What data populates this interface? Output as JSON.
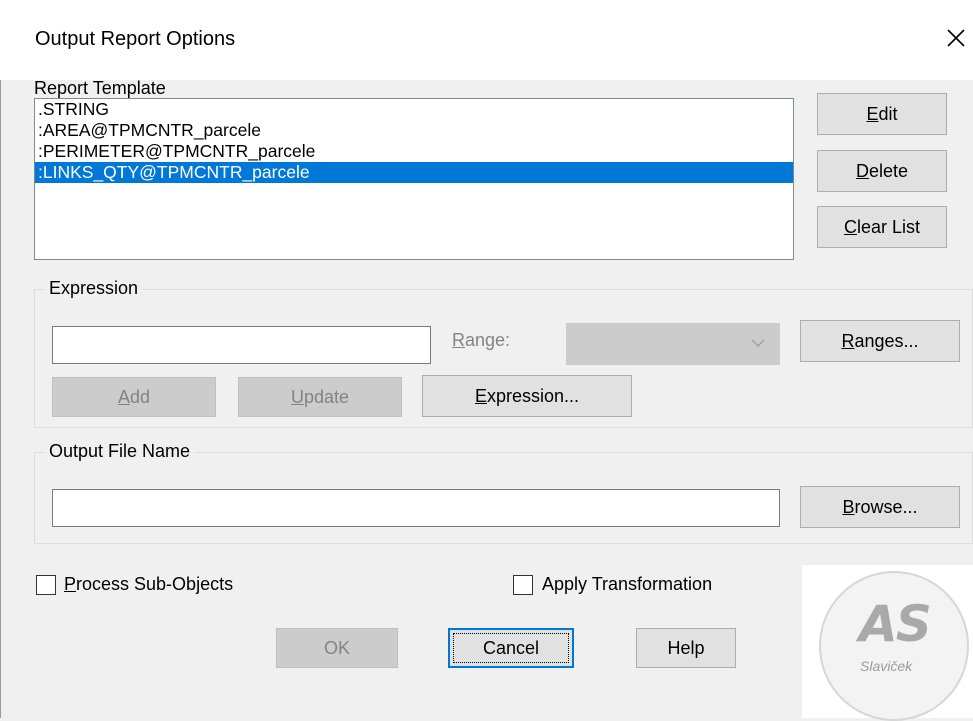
{
  "dialog": {
    "title": "Output Report Options"
  },
  "report_template": {
    "label": "Report Template",
    "items": [
      {
        "text": ".STRING",
        "selected": false
      },
      {
        "text": ":AREA@TPMCNTR_parcele",
        "selected": false
      },
      {
        "text": ":PERIMETER@TPMCNTR_parcele",
        "selected": false
      },
      {
        "text": ":LINKS_QTY@TPMCNTR_parcele",
        "selected": true
      }
    ]
  },
  "side_buttons": {
    "edit": {
      "mnemonic": "E",
      "rest": "dit"
    },
    "delete": {
      "mnemonic": "D",
      "rest": "elete"
    },
    "clear_list": {
      "mnemonic": "C",
      "rest": "lear List"
    }
  },
  "expression_group": {
    "title": "Expression",
    "input_value": "",
    "range_label": {
      "mnemonic": "R",
      "rest": "ange:"
    },
    "range_value": "",
    "ranges_button": {
      "mnemonic": "R",
      "rest": "anges..."
    },
    "add_button": {
      "mnemonic": "A",
      "rest": "dd"
    },
    "update_button": {
      "mnemonic": "U",
      "rest": "pdate"
    },
    "expression_button": {
      "mnemonic": "E",
      "rest": "xpression..."
    }
  },
  "output_group": {
    "title": "Output File Name",
    "input_value": "",
    "browse_button": {
      "mnemonic": "B",
      "rest": "rowse..."
    }
  },
  "checkboxes": {
    "process_sub_objects": {
      "mnemonic": "P",
      "rest": "rocess Sub-Objects",
      "checked": false
    },
    "apply_transformation": {
      "label": "Apply Transformation",
      "checked": false
    }
  },
  "footer": {
    "ok_label": "OK",
    "cancel_label": "Cancel",
    "help_label": "Help"
  },
  "watermark": {
    "logo_text": "AS",
    "name": "Slaviček"
  },
  "colors": {
    "selection": "#0078d7",
    "dialog_bg": "#f0f0f0",
    "disabled_text": "#838383"
  }
}
